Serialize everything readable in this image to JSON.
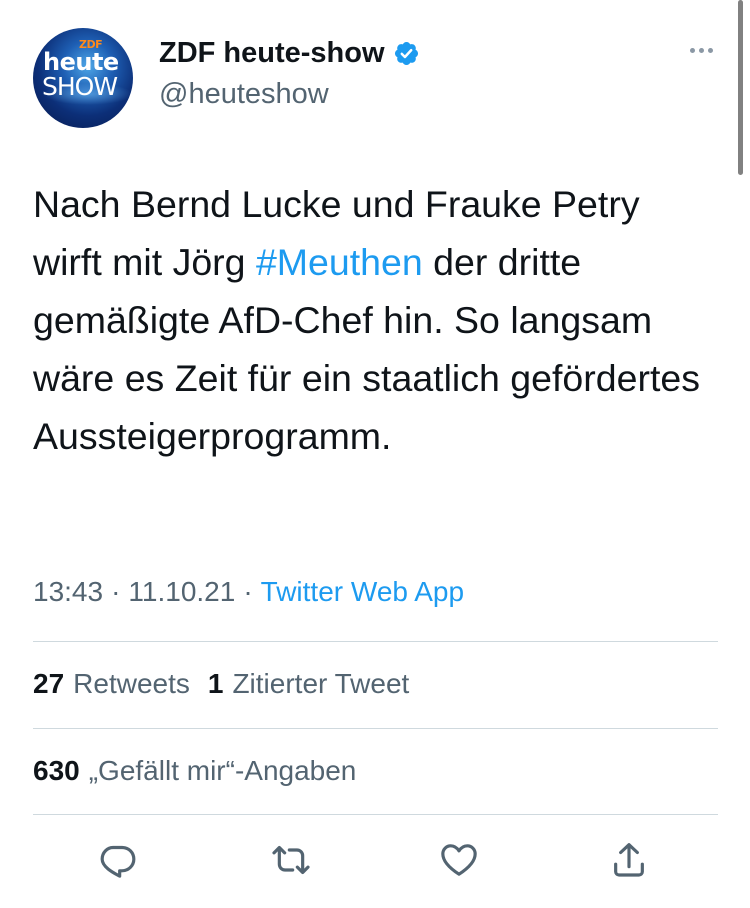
{
  "author": {
    "display_name": "ZDF heute-show",
    "handle": "@heuteshow",
    "verified": true,
    "avatar": {
      "zdf_logo": "ZDF",
      "line1": "heute",
      "line2": "SHOW"
    }
  },
  "tweet": {
    "text_before": "Nach Bernd Lucke und Frauke Petry wirft mit Jörg ",
    "hashtag": "#Meuthen",
    "text_after": " der dritte gemäßigte AfD-Chef hin. So langsam wäre es Zeit für ein staatlich gefördertes Aussteigerprogramm."
  },
  "meta": {
    "time": "13:43",
    "separator": "·",
    "date": "11.10.21",
    "source": "Twitter Web App"
  },
  "stats": {
    "retweets_count": "27",
    "retweets_label": "Retweets",
    "quotes_count": "1",
    "quotes_label": "Zitierter Tweet",
    "likes_count": "630",
    "likes_label": "„Gefällt mir“-Angaben"
  },
  "actions": [
    "reply-icon",
    "retweet-icon",
    "like-icon",
    "share-icon"
  ],
  "colors": {
    "accent": "#1d9bf0",
    "text": "#0f1419",
    "secondary": "#536471",
    "divider": "#cfd9de"
  }
}
